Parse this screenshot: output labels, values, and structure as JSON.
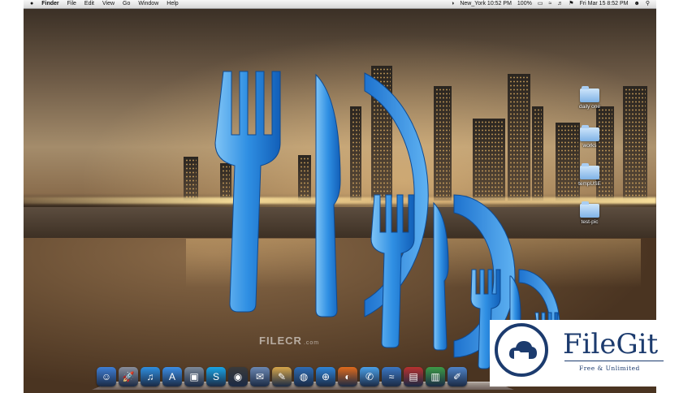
{
  "menubar": {
    "apple": "",
    "app_name": "Finder",
    "menus": [
      "File",
      "Edit",
      "View",
      "Go",
      "Window",
      "Help"
    ],
    "clock_location": "New_York 10:52 PM",
    "battery": "100%",
    "datetime": "Fri Mar 15  8:52 PM"
  },
  "desktop_icons": [
    {
      "label": "daily one"
    },
    {
      "label": "works"
    },
    {
      "label": "tempUSE"
    },
    {
      "label": "test-pic"
    }
  ],
  "watermark": {
    "brand": "FILECR",
    "suffix": ".com"
  },
  "dock": {
    "items": [
      {
        "name": "finder",
        "glyph": "☺",
        "color": "#3f7fd6"
      },
      {
        "name": "launchpad",
        "glyph": "🚀",
        "color": "#8a8f9c"
      },
      {
        "name": "itunes",
        "glyph": "♫",
        "color": "#2f8fe0"
      },
      {
        "name": "app-store",
        "glyph": "A",
        "color": "#3c8ee6"
      },
      {
        "name": "preview",
        "glyph": "▣",
        "color": "#7d8a9a"
      },
      {
        "name": "skype",
        "glyph": "S",
        "color": "#19a5e6"
      },
      {
        "name": "dashboard",
        "glyph": "◉",
        "color": "#3a3a3a"
      },
      {
        "name": "mail",
        "glyph": "✉",
        "color": "#6b88b3"
      },
      {
        "name": "pencil-app",
        "glyph": "✎",
        "color": "#d7a74b"
      },
      {
        "name": "google-earth",
        "glyph": "◍",
        "color": "#2e6cb5"
      },
      {
        "name": "safari",
        "glyph": "⊕",
        "color": "#2f85d8"
      },
      {
        "name": "firefox",
        "glyph": "◐",
        "color": "#e06a1c"
      },
      {
        "name": "messages",
        "glyph": "✆",
        "color": "#4aa0e8"
      },
      {
        "name": "network",
        "glyph": "≈",
        "color": "#3b77c4"
      },
      {
        "name": "pdf",
        "glyph": "▤",
        "color": "#b8312f"
      },
      {
        "name": "stocks",
        "glyph": "▥",
        "color": "#3d9b47"
      },
      {
        "name": "xcode",
        "glyph": "✐",
        "color": "#4f83c8"
      }
    ]
  },
  "badge": {
    "name": "FileGit",
    "tagline": "Free & Unlimited"
  },
  "colors": {
    "logo_blue": "#2a8ae0",
    "badge_navy": "#1c3b6e"
  }
}
